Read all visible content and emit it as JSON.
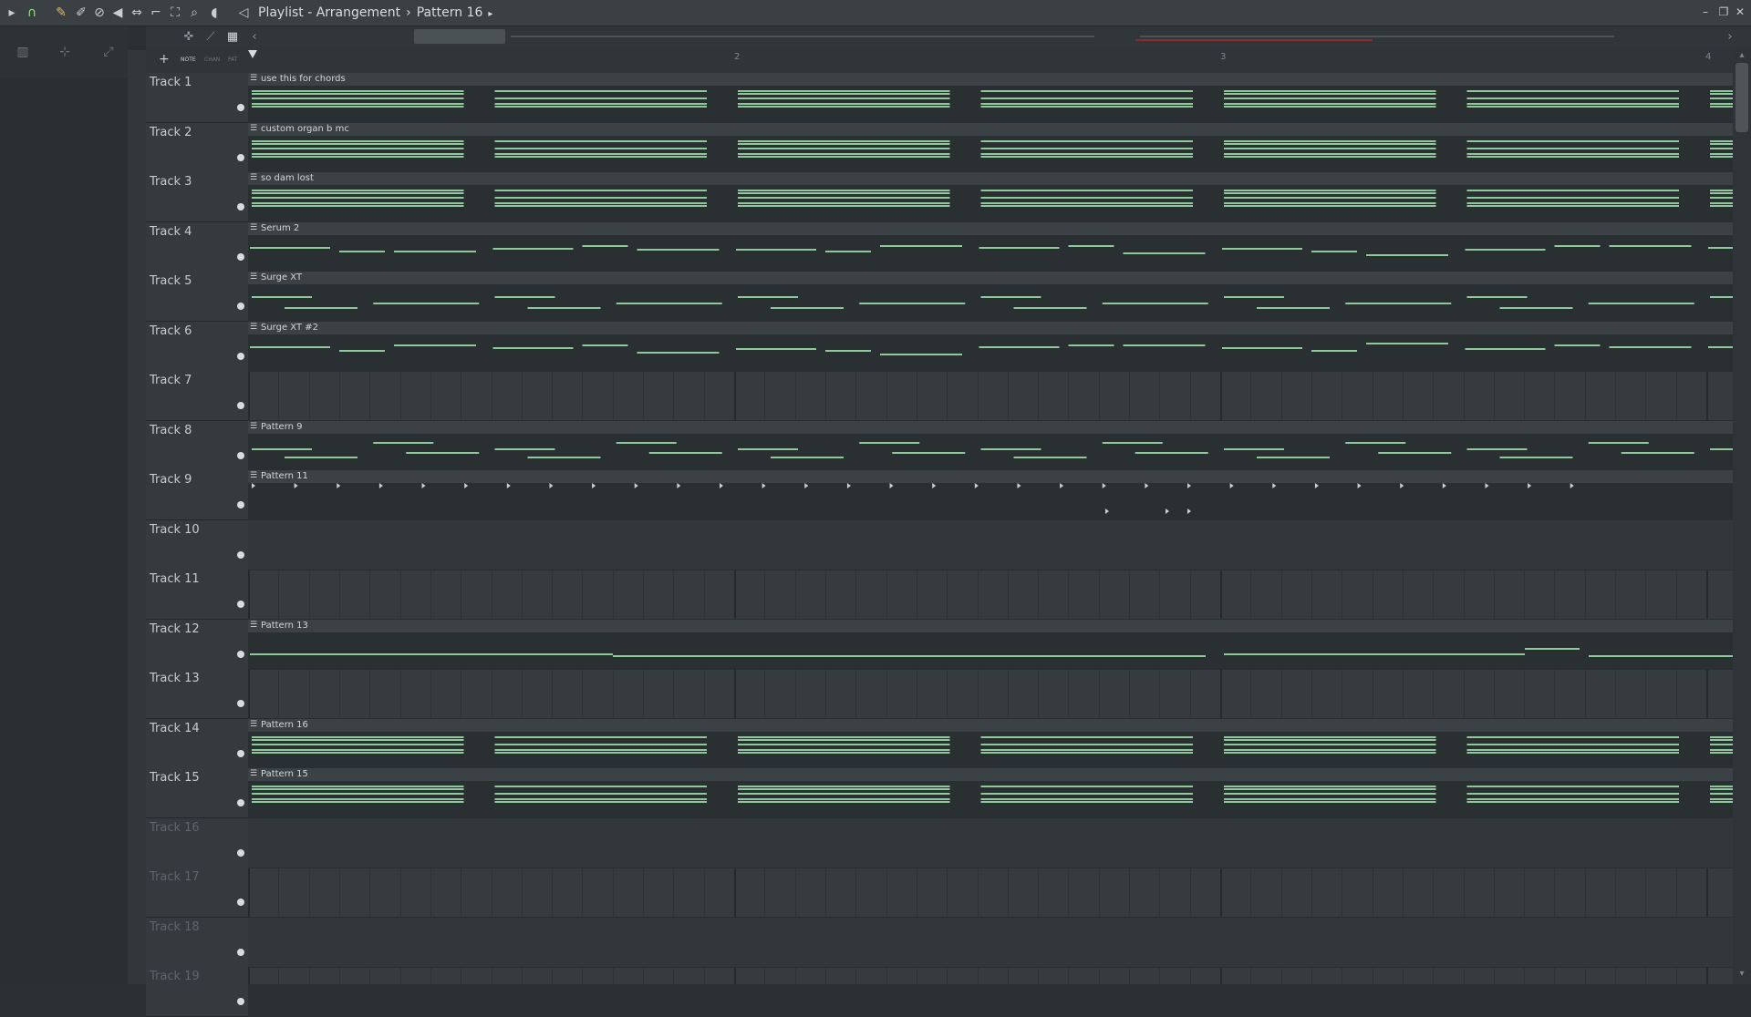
{
  "titlebar": {
    "title": "Playlist - Arrangement",
    "separator": "›",
    "pattern": "Pattern 16",
    "end_arrow": "▸",
    "icons": [
      "play-icon",
      "magnet-icon",
      "pencil-icon",
      "paint-icon",
      "delete-icon",
      "mute-icon",
      "slip-icon",
      "slice-icon",
      "select-icon",
      "zoom-icon",
      "playback-icon"
    ]
  },
  "toolbar": {
    "icons": [
      "tempo-icon",
      "chart-icon",
      "link-icon"
    ],
    "add_label": "+",
    "mode_note": "NOTE",
    "mode_chan": "CHAN",
    "mode_pat": "PAT"
  },
  "ruler": {
    "bars": [
      "2",
      "3",
      "4"
    ]
  },
  "tracks": [
    {
      "name": "Track 1",
      "clip": "use this for chords",
      "kind": "chords"
    },
    {
      "name": "Track 2",
      "clip": "custom organ b mc",
      "kind": "chords"
    },
    {
      "name": "Track 3",
      "clip": "so dam lost",
      "kind": "chords"
    },
    {
      "name": "Track 4",
      "clip": "Serum 2",
      "kind": "melody"
    },
    {
      "name": "Track 5",
      "clip": "Surge XT",
      "kind": "arp"
    },
    {
      "name": "Track 6",
      "clip": "Surge XT #2",
      "kind": "melody"
    },
    {
      "name": "Track 7",
      "clip": "",
      "kind": "empty"
    },
    {
      "name": "Track 8",
      "clip": "Pattern 9",
      "kind": "arp"
    },
    {
      "name": "Track 9",
      "clip": "Pattern 11",
      "kind": "drums"
    },
    {
      "name": "Track 10",
      "clip": "",
      "kind": "empty"
    },
    {
      "name": "Track 11",
      "clip": "",
      "kind": "empty"
    },
    {
      "name": "Track 12",
      "clip": "Pattern 13",
      "kind": "bass"
    },
    {
      "name": "Track 13",
      "clip": "",
      "kind": "empty"
    },
    {
      "name": "Track 14",
      "clip": "Pattern 16",
      "kind": "chords"
    },
    {
      "name": "Track 15",
      "clip": "Pattern 15",
      "kind": "chords"
    },
    {
      "name": "Track 16",
      "clip": "",
      "kind": "empty"
    },
    {
      "name": "Track 17",
      "clip": "",
      "kind": "empty"
    },
    {
      "name": "Track 18",
      "clip": "",
      "kind": "empty"
    },
    {
      "name": "Track 19",
      "clip": "",
      "kind": "empty"
    }
  ],
  "colors": {
    "note": "#8fc89a",
    "clip_bg": "#2a2f32",
    "clip_head": "#3b4246",
    "drum": "#c8d0d4"
  }
}
